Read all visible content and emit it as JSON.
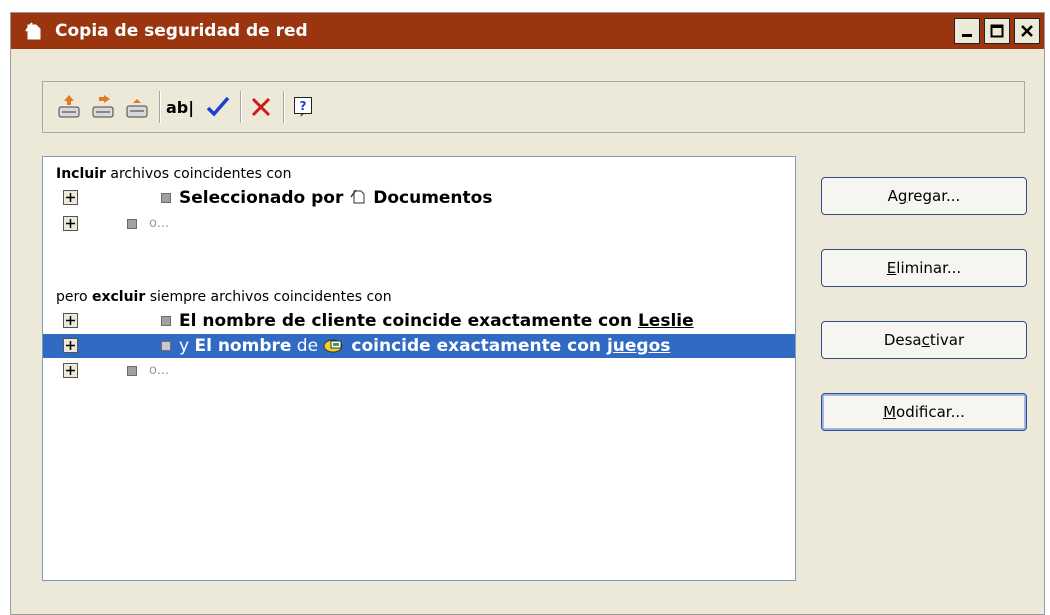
{
  "window": {
    "title": "Copia de seguridad de red"
  },
  "toolbar": {
    "ab_label": "ab|",
    "icons": [
      "document-up-icon",
      "document-forward-icon",
      "document-icon",
      "rename-icon",
      "checkmark-icon",
      "delete-x-icon",
      "help-icon"
    ]
  },
  "include": {
    "header_bold": "Incluir",
    "header_rest": " archivos coincidentes con",
    "rules": [
      {
        "text_bold": "Seleccionado por",
        "text_after": " Documentos"
      }
    ],
    "placeholder": "o..."
  },
  "exclude": {
    "header_pre": "pero ",
    "header_bold": "excluir",
    "header_rest": " siempre archivos coincidentes con",
    "rule1": {
      "text": "El nombre de cliente coincide exactamente con ",
      "link": "Leslie"
    },
    "rule2": {
      "prefix": "y ",
      "text_a": "El nombre",
      "text_b": " de ",
      "text_c": " coincide exactamente con ",
      "link": "juegos"
    },
    "placeholder": "o..."
  },
  "buttons": {
    "add": {
      "pre": "A",
      "u": "g",
      "post": "regar..."
    },
    "remove": {
      "pre": "",
      "u": "E",
      "post": "liminar..."
    },
    "deactivate": {
      "pre": "Desa",
      "u": "c",
      "post": "tivar"
    },
    "modify": {
      "pre": "",
      "u": "M",
      "post": "odificar..."
    }
  },
  "colors": {
    "titlebar": "#9b3510",
    "selection": "#316ac5",
    "background": "#ede9d8"
  }
}
